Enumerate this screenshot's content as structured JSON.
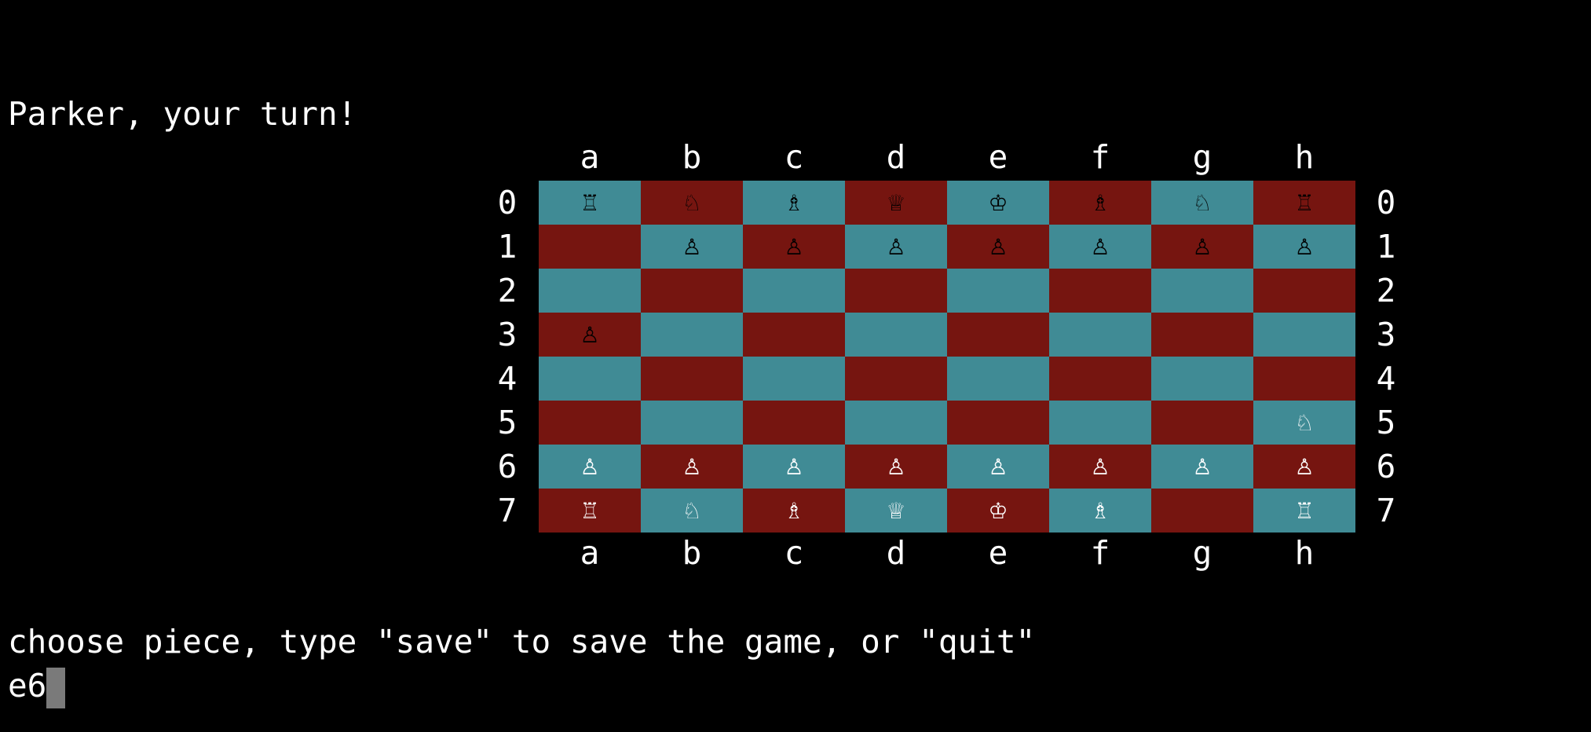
{
  "prompt_turn": "Parker, your turn!",
  "files": [
    "a",
    "b",
    "c",
    "d",
    "e",
    "f",
    "g",
    "h"
  ],
  "colors": {
    "light_square": "#408b95",
    "dark_square": "#761510",
    "black_piece": "#000000",
    "white_piece": "#ffffff",
    "cursor": "#7a7a7a"
  },
  "board": [
    {
      "rank": "0",
      "cells": [
        {
          "p": "♖",
          "c": "black"
        },
        {
          "p": "♘",
          "c": "black"
        },
        {
          "p": "♗",
          "c": "black"
        },
        {
          "p": "♕",
          "c": "black"
        },
        {
          "p": "♔",
          "c": "black"
        },
        {
          "p": "♗",
          "c": "black"
        },
        {
          "p": "♘",
          "c": "black"
        },
        {
          "p": "♖",
          "c": "black"
        }
      ]
    },
    {
      "rank": "1",
      "cells": [
        null,
        {
          "p": "♙",
          "c": "black"
        },
        {
          "p": "♙",
          "c": "black"
        },
        {
          "p": "♙",
          "c": "black"
        },
        {
          "p": "♙",
          "c": "black"
        },
        {
          "p": "♙",
          "c": "black"
        },
        {
          "p": "♙",
          "c": "black"
        },
        {
          "p": "♙",
          "c": "black"
        }
      ]
    },
    {
      "rank": "2",
      "cells": [
        null,
        null,
        null,
        null,
        null,
        null,
        null,
        null
      ]
    },
    {
      "rank": "3",
      "cells": [
        {
          "p": "♙",
          "c": "black"
        },
        null,
        null,
        null,
        null,
        null,
        null,
        null
      ]
    },
    {
      "rank": "4",
      "cells": [
        null,
        null,
        null,
        null,
        null,
        null,
        null,
        null
      ]
    },
    {
      "rank": "5",
      "cells": [
        null,
        null,
        null,
        null,
        null,
        null,
        null,
        {
          "p": "♘",
          "c": "white"
        }
      ]
    },
    {
      "rank": "6",
      "cells": [
        {
          "p": "♙",
          "c": "white"
        },
        {
          "p": "♙",
          "c": "white"
        },
        {
          "p": "♙",
          "c": "white"
        },
        {
          "p": "♙",
          "c": "white"
        },
        {
          "p": "♙",
          "c": "white"
        },
        {
          "p": "♙",
          "c": "white"
        },
        {
          "p": "♙",
          "c": "white"
        },
        {
          "p": "♙",
          "c": "white"
        }
      ]
    },
    {
      "rank": "7",
      "cells": [
        {
          "p": "♖",
          "c": "white"
        },
        {
          "p": "♘",
          "c": "white"
        },
        {
          "p": "♗",
          "c": "white"
        },
        {
          "p": "♕",
          "c": "white"
        },
        {
          "p": "♔",
          "c": "white"
        },
        {
          "p": "♗",
          "c": "white"
        },
        null,
        {
          "p": "♖",
          "c": "white"
        }
      ]
    }
  ],
  "instruction": "choose piece, type \"save\" to save the game, or \"quit\"",
  "input_value": "e6"
}
